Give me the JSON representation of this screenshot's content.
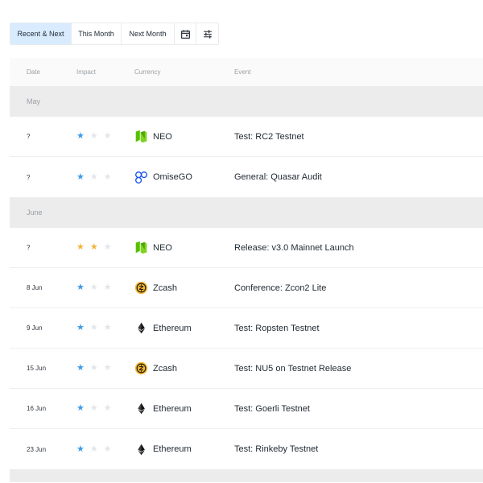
{
  "tabs": {
    "recent_next": "Recent & Next",
    "this_month": "This Month",
    "next_month": "Next Month",
    "calendar_icon": "calendar-icon",
    "filter_icon": "sliders-icon"
  },
  "table": {
    "headers": {
      "date": "Date",
      "impact": "Impact",
      "currency": "Currency",
      "event": "Event"
    },
    "groups": [
      {
        "label": "May",
        "rows": [
          {
            "date": "?",
            "impact": 1,
            "impact_color": "#3d9ae8",
            "currency": "NEO",
            "coin": "neo",
            "event": "Test: RC2 Testnet"
          },
          {
            "date": "?",
            "impact": 1,
            "impact_color": "#3d9ae8",
            "currency": "OmiseGO",
            "coin": "omisego",
            "event": "General: Quasar Audit"
          }
        ]
      },
      {
        "label": "June",
        "rows": [
          {
            "date": "?",
            "impact": 2,
            "impact_color": "#f4b336",
            "currency": "NEO",
            "coin": "neo",
            "event": "Release: v3.0 Mainnet Launch"
          },
          {
            "date": "8 Jun",
            "impact": 1,
            "impact_color": "#3d9ae8",
            "currency": "Zcash",
            "coin": "zcash",
            "event": "Conference: Zcon2 Lite"
          },
          {
            "date": "9 Jun",
            "impact": 1,
            "impact_color": "#3d9ae8",
            "currency": "Ethereum",
            "coin": "ethereum",
            "event": "Test: Ropsten Testnet"
          },
          {
            "date": "15 Jun",
            "impact": 1,
            "impact_color": "#3d9ae8",
            "currency": "Zcash",
            "coin": "zcash",
            "event": "Test: NU5 on Testnet Release"
          },
          {
            "date": "16 Jun",
            "impact": 1,
            "impact_color": "#3d9ae8",
            "currency": "Ethereum",
            "coin": "ethereum",
            "event": "Test: Goerli Testnet"
          },
          {
            "date": "23 Jun",
            "impact": 1,
            "impact_color": "#3d9ae8",
            "currency": "Ethereum",
            "coin": "ethereum",
            "event": "Test: Rinkeby Testnet"
          }
        ]
      }
    ]
  }
}
